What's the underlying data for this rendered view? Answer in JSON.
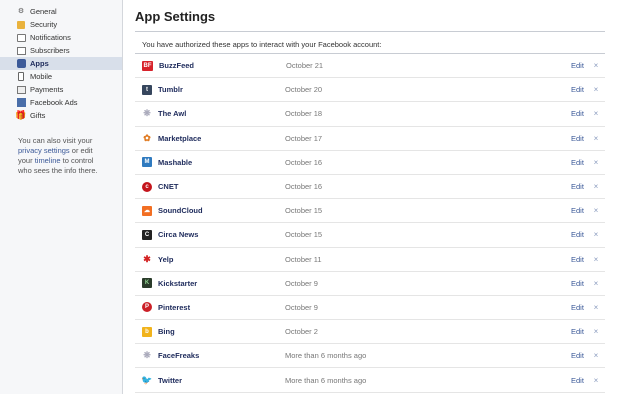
{
  "sidebar": {
    "items": [
      {
        "label": "General",
        "icon": "gear-icon",
        "active": false
      },
      {
        "label": "Security",
        "icon": "lock-icon",
        "active": false
      },
      {
        "label": "Notifications",
        "icon": "notifications-icon",
        "active": false
      },
      {
        "label": "Subscribers",
        "icon": "subscribers-icon",
        "active": false
      },
      {
        "label": "Apps",
        "icon": "apps-icon",
        "active": true
      },
      {
        "label": "Mobile",
        "icon": "mobile-icon",
        "active": false
      },
      {
        "label": "Payments",
        "icon": "payments-icon",
        "active": false
      },
      {
        "label": "Facebook Ads",
        "icon": "facebook-ads-icon",
        "active": false
      },
      {
        "label": "Gifts",
        "icon": "gift-icon",
        "active": false
      }
    ],
    "note": {
      "prefix": "You can also visit your",
      "privacy_link": "privacy settings",
      "middle": "or edit your",
      "timeline_link": "timeline",
      "suffix": "to control who sees the info there."
    }
  },
  "main": {
    "title": "App Settings",
    "intro": "You have authorized these apps to interact with your Facebook account:",
    "edit_label": "Edit",
    "remove_label": "×",
    "apps": [
      {
        "name": "BuzzFeed",
        "date": "October 21",
        "icon": "buzzfeed-icon",
        "glyph": "BF"
      },
      {
        "name": "Tumblr",
        "date": "October 20",
        "icon": "tumblr-icon",
        "glyph": "t"
      },
      {
        "name": "The Awl",
        "date": "October 18",
        "icon": "the-awl-icon",
        "glyph": "❋"
      },
      {
        "name": "Marketplace",
        "date": "October 17",
        "icon": "marketplace-icon",
        "glyph": "✿"
      },
      {
        "name": "Mashable",
        "date": "October 16",
        "icon": "mashable-icon",
        "glyph": "M"
      },
      {
        "name": "CNET",
        "date": "October 16",
        "icon": "cnet-icon",
        "glyph": "c"
      },
      {
        "name": "SoundCloud",
        "date": "October 15",
        "icon": "soundcloud-icon",
        "glyph": "☁"
      },
      {
        "name": "Circa News",
        "date": "October 15",
        "icon": "circa-news-icon",
        "glyph": "C"
      },
      {
        "name": "Yelp",
        "date": "October 11",
        "icon": "yelp-icon",
        "glyph": "✱"
      },
      {
        "name": "Kickstarter",
        "date": "October 9",
        "icon": "kickstarter-icon",
        "glyph": "K"
      },
      {
        "name": "Pinterest",
        "date": "October 9",
        "icon": "pinterest-icon",
        "glyph": "P"
      },
      {
        "name": "Bing",
        "date": "October 2",
        "icon": "bing-icon",
        "glyph": "b"
      },
      {
        "name": "FaceFreaks",
        "date": "More than 6 months ago",
        "icon": "facefreaks-icon",
        "glyph": "❋"
      },
      {
        "name": "Twitter",
        "date": "More than 6 months ago",
        "icon": "twitter-icon",
        "glyph": "🐦"
      }
    ]
  }
}
